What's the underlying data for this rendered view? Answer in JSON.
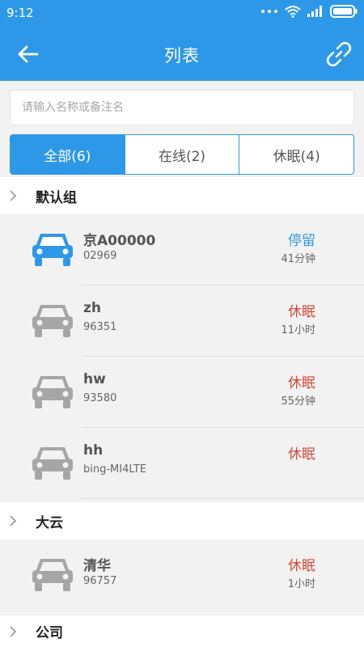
{
  "status_bar": {
    "time": "9:12",
    "icons": [
      "more-icon",
      "wifi-icon",
      "signal-icon",
      "battery-icon"
    ]
  },
  "app_bar": {
    "title": "列表",
    "back_icon": "arrow-left-icon",
    "action_icon": "link-icon"
  },
  "search": {
    "placeholder": "请输入名称或备注名",
    "value": ""
  },
  "tabs": [
    {
      "label": "全部(6)",
      "active": true
    },
    {
      "label": "在线(2)",
      "active": false
    },
    {
      "label": "休眠(4)",
      "active": false
    }
  ],
  "groups": [
    {
      "name": "默认组",
      "vehicles": [
        {
          "name": "京A00000",
          "id": "02969",
          "status": "停留",
          "duration": "41分钟",
          "color": "#2e98e8"
        },
        {
          "name": "zh",
          "id": "96351",
          "status": "休眠",
          "duration": "11小时",
          "color": "#d24a37"
        },
        {
          "name": "hw",
          "id": "93580",
          "status": "休眠",
          "duration": "55分钟",
          "color": "#d24a37"
        },
        {
          "name": "hh",
          "id": "bing-MI4LTE",
          "status": "休眠",
          "duration": "",
          "color": "#d24a37"
        }
      ]
    },
    {
      "name": "大云",
      "vehicles": [
        {
          "name": "清华",
          "id": "96757",
          "status": "休眠",
          "duration": "1小时",
          "color": "#d24a37"
        }
      ]
    },
    {
      "name": "公司",
      "vehicles": []
    }
  ],
  "colors": {
    "primary": "#2e98e8",
    "status_sleep": "#d24a37",
    "car_inactive": "#a6a6a6"
  }
}
